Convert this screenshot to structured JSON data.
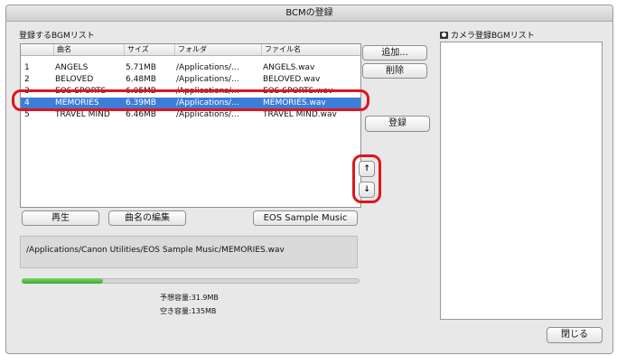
{
  "window": {
    "title": "BCMの登録"
  },
  "left_panel": {
    "label": "登録するBGMリスト",
    "columns": [
      "曲名",
      "サイズ",
      "フォルダ",
      "ファイル名"
    ],
    "rows": [
      {
        "num": "1",
        "name": "ANGELS",
        "size": "5.71MB",
        "folder": "/Applications/...",
        "file": "ANGELS.wav"
      },
      {
        "num": "2",
        "name": "BELOVED",
        "size": "6.48MB",
        "folder": "/Applications/...",
        "file": "BELOVED.wav"
      },
      {
        "num": "3",
        "name": "EOS SPORTS",
        "size": "6.05MB",
        "folder": "/Applications/...",
        "file": "EOS SPORTS.wav"
      },
      {
        "num": "4",
        "name": "MEMORIES",
        "size": "6.39MB",
        "folder": "/Applications/...",
        "file": "MEMORIES.wav"
      },
      {
        "num": "5",
        "name": "TRAVEL MIND",
        "size": "6.46MB",
        "folder": "/Applications/...",
        "file": "TRAVEL MIND.wav"
      }
    ],
    "selected_index": 3
  },
  "buttons": {
    "add": "追加...",
    "delete": "削除",
    "register": "登録",
    "move_up_glyph": "↑",
    "move_down_glyph": "↓",
    "play": "再生",
    "edit_title": "曲名の編集",
    "sample_music": "EOS Sample Music",
    "close": "閉じる"
  },
  "path_display": "/Applications/Canon Utilities/EOS Sample Music/MEMORIES.wav",
  "progress": {
    "fraction": 0.24
  },
  "capacity": {
    "expected": "予想容量:31.9MB",
    "free": "空き容量:135MB"
  },
  "right_panel": {
    "label": "カメラ登録BGMリスト",
    "icon": "camera-icon"
  },
  "colors": {
    "selection": "#3b7dd8",
    "highlight": "#e0141e",
    "progress": "#3aa82a"
  }
}
